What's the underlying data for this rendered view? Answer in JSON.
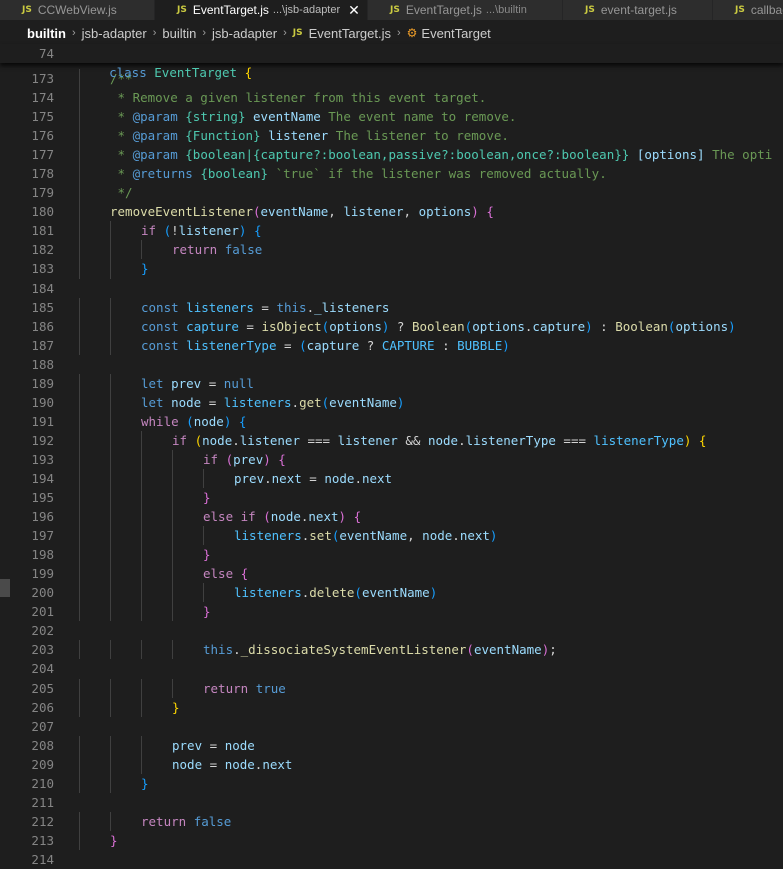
{
  "tabs": [
    {
      "label": "CCWebView.js",
      "desc": "",
      "active": false
    },
    {
      "label": "EventTarget.js",
      "desc": "...\\jsb-adapter",
      "active": true
    },
    {
      "label": "EventTarget.js",
      "desc": "...\\builtin",
      "active": false
    },
    {
      "label": "event-target.js",
      "desc": "",
      "active": false
    },
    {
      "label": "callback",
      "desc": "",
      "active": false
    }
  ],
  "file_icon_text": "JS",
  "breadcrumb": [
    "builtin",
    "jsb-adapter",
    "builtin",
    "jsb-adapter",
    "EventTarget.js",
    "EventTarget"
  ],
  "sticky": {
    "line": "74",
    "code": "class EventTarget {"
  },
  "lines": [
    {
      "n": "173",
      "i": 1,
      "t": [
        [
          "cm",
          "/**"
        ]
      ]
    },
    {
      "n": "174",
      "i": 1,
      "t": [
        [
          "cm",
          " * Remove a given listener from this event target."
        ]
      ]
    },
    {
      "n": "175",
      "i": 1,
      "t": [
        [
          "cm",
          " * "
        ],
        [
          "kw",
          "@param"
        ],
        [
          "cm",
          " "
        ],
        [
          "cls",
          "{string}"
        ],
        [
          "cm",
          " "
        ],
        [
          "var",
          "eventName"
        ],
        [
          "cm",
          " The event name to remove."
        ]
      ]
    },
    {
      "n": "176",
      "i": 1,
      "t": [
        [
          "cm",
          " * "
        ],
        [
          "kw",
          "@param"
        ],
        [
          "cm",
          " "
        ],
        [
          "cls",
          "{Function}"
        ],
        [
          "cm",
          " "
        ],
        [
          "var",
          "listener"
        ],
        [
          "cm",
          " The listener to remove."
        ]
      ]
    },
    {
      "n": "177",
      "i": 1,
      "t": [
        [
          "cm",
          " * "
        ],
        [
          "kw",
          "@param"
        ],
        [
          "cm",
          " "
        ],
        [
          "cls",
          "{boolean|{capture?:boolean,passive?:boolean,once?:boolean}}"
        ],
        [
          "cm",
          " "
        ],
        [
          "var",
          "[options]"
        ],
        [
          "cm",
          " The opti"
        ]
      ]
    },
    {
      "n": "178",
      "i": 1,
      "t": [
        [
          "cm",
          " * "
        ],
        [
          "kw",
          "@returns"
        ],
        [
          "cm",
          " "
        ],
        [
          "cls",
          "{boolean}"
        ],
        [
          "cm",
          " `true` if the listener was removed actually."
        ]
      ]
    },
    {
      "n": "179",
      "i": 1,
      "t": [
        [
          "cm",
          " */"
        ]
      ]
    },
    {
      "n": "180",
      "i": 1,
      "t": [
        [
          "fn",
          "removeEventListener"
        ],
        [
          "p2",
          "("
        ],
        [
          "var",
          "eventName"
        ],
        [
          "op",
          ", "
        ],
        [
          "var",
          "listener"
        ],
        [
          "op",
          ", "
        ],
        [
          "var",
          "options"
        ],
        [
          "p2",
          ")"
        ],
        [
          "op",
          " "
        ],
        [
          "p2",
          "{"
        ]
      ]
    },
    {
      "n": "181",
      "i": 2,
      "t": [
        [
          "ctl",
          "if"
        ],
        [
          "op",
          " "
        ],
        [
          "p3",
          "("
        ],
        [
          "op",
          "!"
        ],
        [
          "var",
          "listener"
        ],
        [
          "p3",
          ")"
        ],
        [
          "op",
          " "
        ],
        [
          "p3",
          "{"
        ]
      ]
    },
    {
      "n": "182",
      "i": 3,
      "t": [
        [
          "ctl",
          "return"
        ],
        [
          "op",
          " "
        ],
        [
          "kw",
          "false"
        ]
      ]
    },
    {
      "n": "183",
      "i": 2,
      "t": [
        [
          "p3",
          "}"
        ]
      ]
    },
    {
      "n": "184",
      "i": 0,
      "t": []
    },
    {
      "n": "185",
      "i": 2,
      "t": [
        [
          "kw",
          "const"
        ],
        [
          "op",
          " "
        ],
        [
          "const",
          "listeners"
        ],
        [
          "op",
          " = "
        ],
        [
          "kw",
          "this"
        ],
        [
          "op",
          "."
        ],
        [
          "var",
          "_listeners"
        ]
      ]
    },
    {
      "n": "186",
      "i": 2,
      "t": [
        [
          "kw",
          "const"
        ],
        [
          "op",
          " "
        ],
        [
          "const",
          "capture"
        ],
        [
          "op",
          " = "
        ],
        [
          "fn",
          "isObject"
        ],
        [
          "p3",
          "("
        ],
        [
          "var",
          "options"
        ],
        [
          "p3",
          ")"
        ],
        [
          "op",
          " ? "
        ],
        [
          "fn",
          "Boolean"
        ],
        [
          "p3",
          "("
        ],
        [
          "var",
          "options"
        ],
        [
          "op",
          "."
        ],
        [
          "var",
          "capture"
        ],
        [
          "p3",
          ")"
        ],
        [
          "op",
          " : "
        ],
        [
          "fn",
          "Boolean"
        ],
        [
          "p3",
          "("
        ],
        [
          "var",
          "options"
        ],
        [
          "p3",
          ")"
        ]
      ]
    },
    {
      "n": "187",
      "i": 2,
      "t": [
        [
          "kw",
          "const"
        ],
        [
          "op",
          " "
        ],
        [
          "const",
          "listenerType"
        ],
        [
          "op",
          " = "
        ],
        [
          "p3",
          "("
        ],
        [
          "var",
          "capture"
        ],
        [
          "op",
          " ? "
        ],
        [
          "const",
          "CAPTURE"
        ],
        [
          "op",
          " : "
        ],
        [
          "const",
          "BUBBLE"
        ],
        [
          "p3",
          ")"
        ]
      ]
    },
    {
      "n": "188",
      "i": 0,
      "t": []
    },
    {
      "n": "189",
      "i": 2,
      "t": [
        [
          "kw",
          "let"
        ],
        [
          "op",
          " "
        ],
        [
          "var",
          "prev"
        ],
        [
          "op",
          " = "
        ],
        [
          "kw",
          "null"
        ]
      ]
    },
    {
      "n": "190",
      "i": 2,
      "t": [
        [
          "kw",
          "let"
        ],
        [
          "op",
          " "
        ],
        [
          "var",
          "node"
        ],
        [
          "op",
          " = "
        ],
        [
          "const",
          "listeners"
        ],
        [
          "op",
          "."
        ],
        [
          "fn",
          "get"
        ],
        [
          "p3",
          "("
        ],
        [
          "var",
          "eventName"
        ],
        [
          "p3",
          ")"
        ]
      ]
    },
    {
      "n": "191",
      "i": 2,
      "t": [
        [
          "ctl",
          "while"
        ],
        [
          "op",
          " "
        ],
        [
          "p3",
          "("
        ],
        [
          "var",
          "node"
        ],
        [
          "p3",
          ")"
        ],
        [
          "op",
          " "
        ],
        [
          "p3",
          "{"
        ]
      ]
    },
    {
      "n": "192",
      "i": 3,
      "t": [
        [
          "ctl",
          "if"
        ],
        [
          "op",
          " "
        ],
        [
          "p1",
          "("
        ],
        [
          "var",
          "node"
        ],
        [
          "op",
          "."
        ],
        [
          "var",
          "listener"
        ],
        [
          "op",
          " === "
        ],
        [
          "var",
          "listener"
        ],
        [
          "op",
          " && "
        ],
        [
          "var",
          "node"
        ],
        [
          "op",
          "."
        ],
        [
          "var",
          "listenerType"
        ],
        [
          "op",
          " === "
        ],
        [
          "const",
          "listenerType"
        ],
        [
          "p1",
          ")"
        ],
        [
          "op",
          " "
        ],
        [
          "p1",
          "{"
        ]
      ]
    },
    {
      "n": "193",
      "i": 4,
      "t": [
        [
          "ctl",
          "if"
        ],
        [
          "op",
          " "
        ],
        [
          "p2",
          "("
        ],
        [
          "var",
          "prev"
        ],
        [
          "p2",
          ")"
        ],
        [
          "op",
          " "
        ],
        [
          "p2",
          "{"
        ]
      ]
    },
    {
      "n": "194",
      "i": 5,
      "t": [
        [
          "var",
          "prev"
        ],
        [
          "op",
          "."
        ],
        [
          "var",
          "next"
        ],
        [
          "op",
          " = "
        ],
        [
          "var",
          "node"
        ],
        [
          "op",
          "."
        ],
        [
          "var",
          "next"
        ]
      ]
    },
    {
      "n": "195",
      "i": 4,
      "t": [
        [
          "p2",
          "}"
        ]
      ]
    },
    {
      "n": "196",
      "i": 4,
      "t": [
        [
          "ctl",
          "else"
        ],
        [
          "op",
          " "
        ],
        [
          "ctl",
          "if"
        ],
        [
          "op",
          " "
        ],
        [
          "p2",
          "("
        ],
        [
          "var",
          "node"
        ],
        [
          "op",
          "."
        ],
        [
          "var",
          "next"
        ],
        [
          "p2",
          ")"
        ],
        [
          "op",
          " "
        ],
        [
          "p2",
          "{"
        ]
      ]
    },
    {
      "n": "197",
      "i": 5,
      "t": [
        [
          "const",
          "listeners"
        ],
        [
          "op",
          "."
        ],
        [
          "fn",
          "set"
        ],
        [
          "p3",
          "("
        ],
        [
          "var",
          "eventName"
        ],
        [
          "op",
          ", "
        ],
        [
          "var",
          "node"
        ],
        [
          "op",
          "."
        ],
        [
          "var",
          "next"
        ],
        [
          "p3",
          ")"
        ]
      ]
    },
    {
      "n": "198",
      "i": 4,
      "t": [
        [
          "p2",
          "}"
        ]
      ]
    },
    {
      "n": "199",
      "i": 4,
      "t": [
        [
          "ctl",
          "else"
        ],
        [
          "op",
          " "
        ],
        [
          "p2",
          "{"
        ]
      ]
    },
    {
      "n": "200",
      "i": 5,
      "t": [
        [
          "const",
          "listeners"
        ],
        [
          "op",
          "."
        ],
        [
          "fn",
          "delete"
        ],
        [
          "p3",
          "("
        ],
        [
          "var",
          "eventName"
        ],
        [
          "p3",
          ")"
        ]
      ]
    },
    {
      "n": "201",
      "i": 4,
      "t": [
        [
          "p2",
          "}"
        ]
      ]
    },
    {
      "n": "202",
      "i": 0,
      "t": []
    },
    {
      "n": "203",
      "i": 4,
      "t": [
        [
          "kw",
          "this"
        ],
        [
          "op",
          "."
        ],
        [
          "fn",
          "_dissociateSystemEventListener"
        ],
        [
          "p2",
          "("
        ],
        [
          "var",
          "eventName"
        ],
        [
          "p2",
          ")"
        ],
        [
          "op",
          ";"
        ]
      ]
    },
    {
      "n": "204",
      "i": 0,
      "t": []
    },
    {
      "n": "205",
      "i": 4,
      "t": [
        [
          "ctl",
          "return"
        ],
        [
          "op",
          " "
        ],
        [
          "kw",
          "true"
        ]
      ]
    },
    {
      "n": "206",
      "i": 3,
      "t": [
        [
          "p1",
          "}"
        ]
      ]
    },
    {
      "n": "207",
      "i": 0,
      "t": []
    },
    {
      "n": "208",
      "i": 3,
      "t": [
        [
          "var",
          "prev"
        ],
        [
          "op",
          " = "
        ],
        [
          "var",
          "node"
        ]
      ]
    },
    {
      "n": "209",
      "i": 3,
      "t": [
        [
          "var",
          "node"
        ],
        [
          "op",
          " = "
        ],
        [
          "var",
          "node"
        ],
        [
          "op",
          "."
        ],
        [
          "var",
          "next"
        ]
      ]
    },
    {
      "n": "210",
      "i": 2,
      "t": [
        [
          "p3",
          "}"
        ]
      ]
    },
    {
      "n": "211",
      "i": 0,
      "t": []
    },
    {
      "n": "212",
      "i": 2,
      "t": [
        [
          "ctl",
          "return"
        ],
        [
          "op",
          " "
        ],
        [
          "kw",
          "false"
        ]
      ]
    },
    {
      "n": "213",
      "i": 1,
      "t": [
        [
          "p2",
          "}"
        ]
      ]
    },
    {
      "n": "214",
      "i": 0,
      "t": []
    }
  ]
}
